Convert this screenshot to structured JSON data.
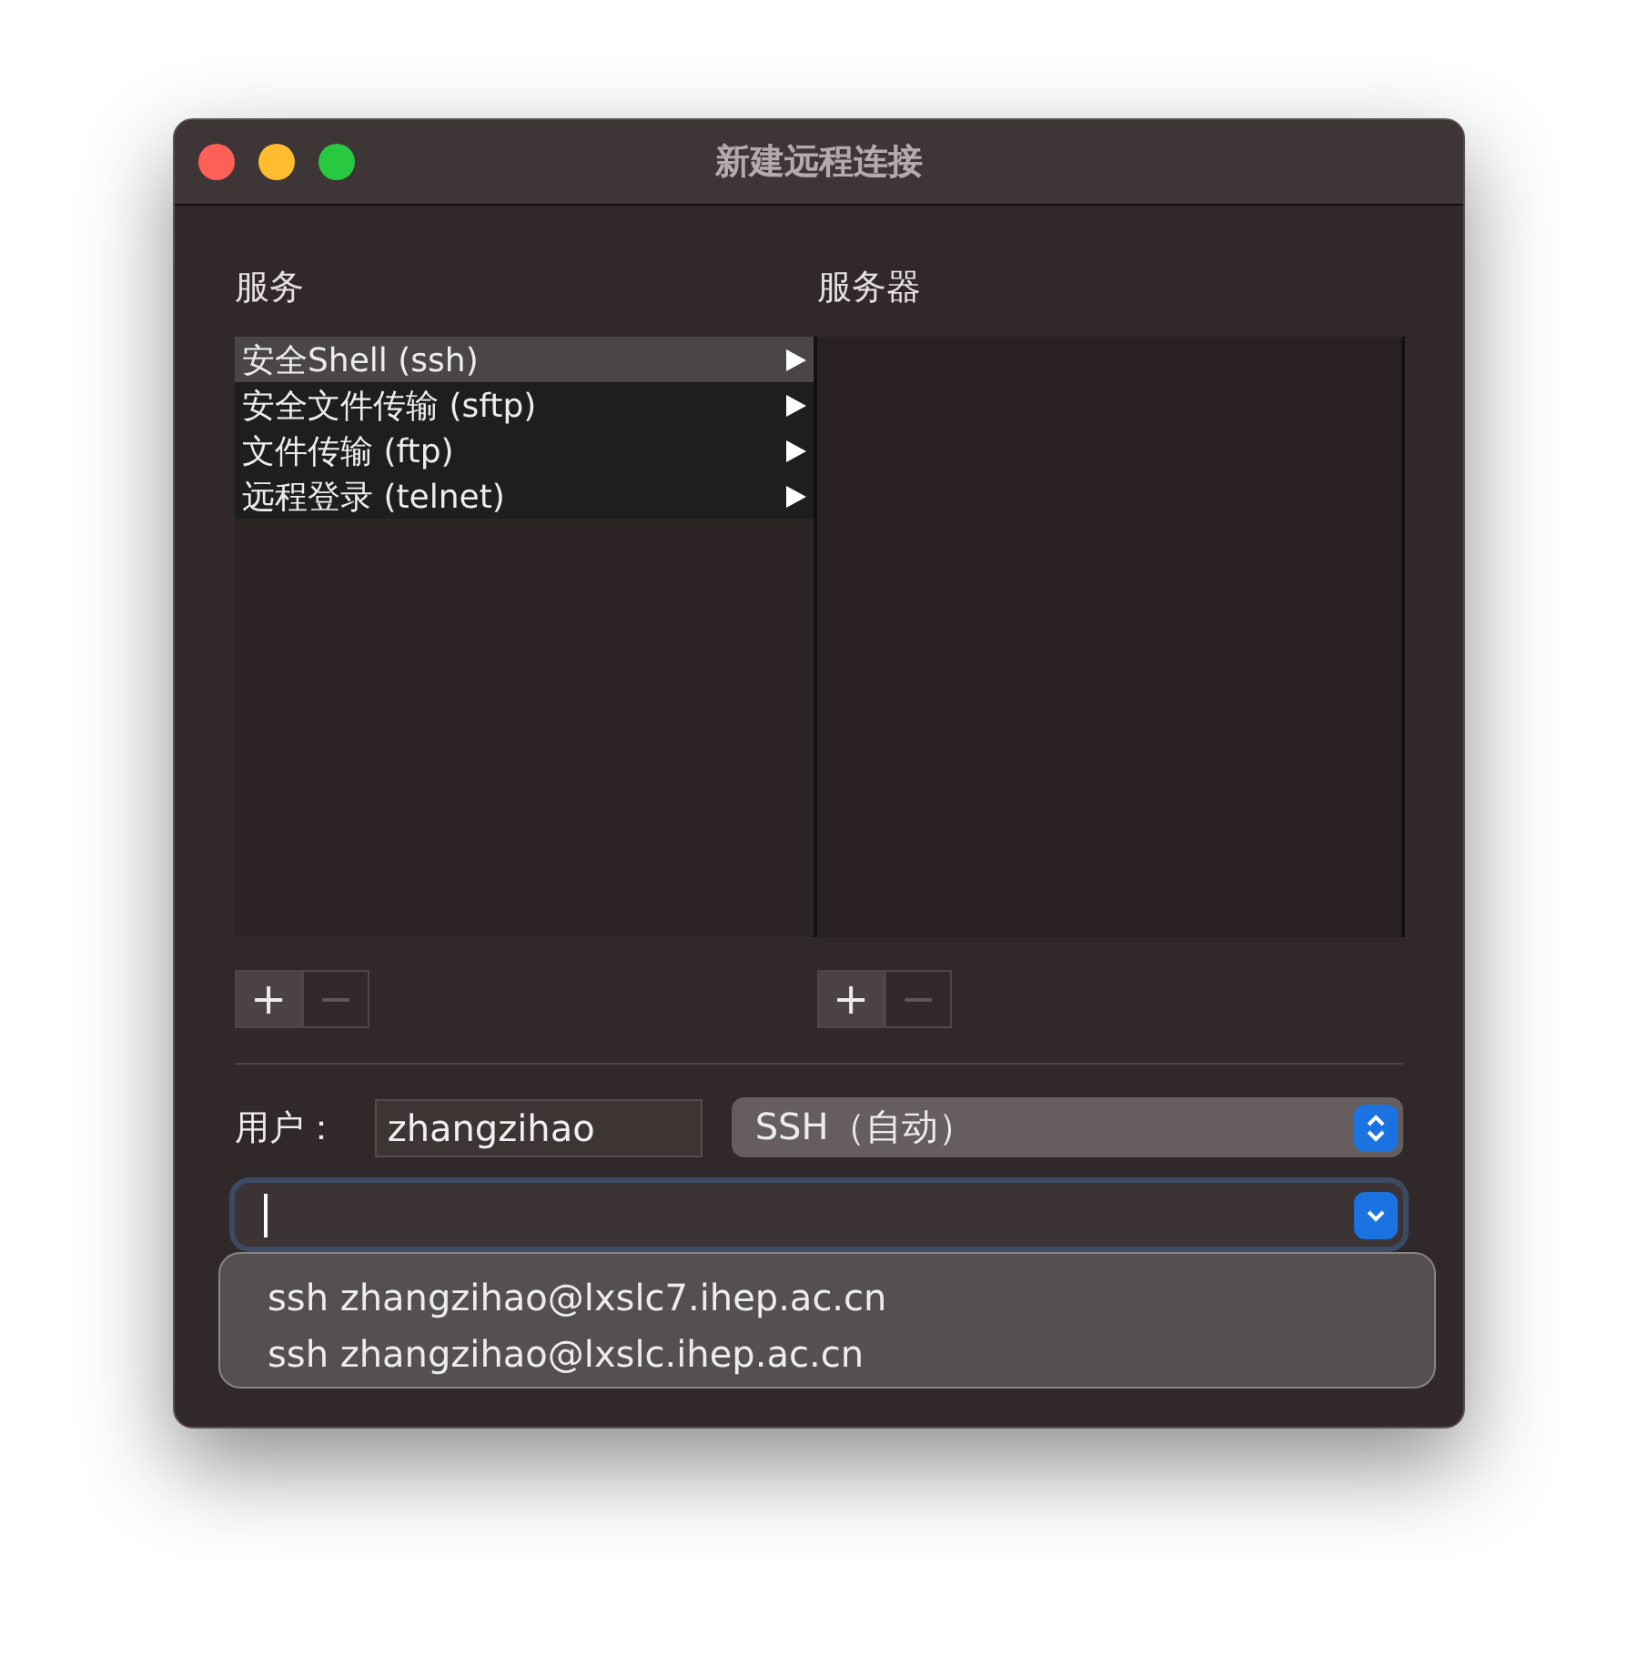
{
  "window": {
    "title": "新建远程连接"
  },
  "services": {
    "label": "服务",
    "items": [
      {
        "label": "安全Shell (ssh)",
        "selected": true
      },
      {
        "label": "安全文件传输 (sftp)",
        "selected": false
      },
      {
        "label": "文件传输 (ftp)",
        "selected": false
      },
      {
        "label": "远程登录 (telnet)",
        "selected": false
      }
    ],
    "buttons": [
      {
        "label": "+",
        "disabled": false
      },
      {
        "label": "−",
        "disabled": true
      }
    ]
  },
  "servers": {
    "label": "服务器",
    "buttons": [
      {
        "label": "+",
        "disabled": false
      },
      {
        "label": "−",
        "disabled": true
      }
    ]
  },
  "user": {
    "label": "用户：",
    "value": "zhangzihao"
  },
  "protocol": {
    "value": "SSH（自动）"
  },
  "command": {
    "focused": true
  },
  "suggestions": [
    "ssh zhangzihao@lxslc7.ihep.ac.cn",
    "ssh zhangzihao@lxslc.ihep.ac.cn"
  ]
}
